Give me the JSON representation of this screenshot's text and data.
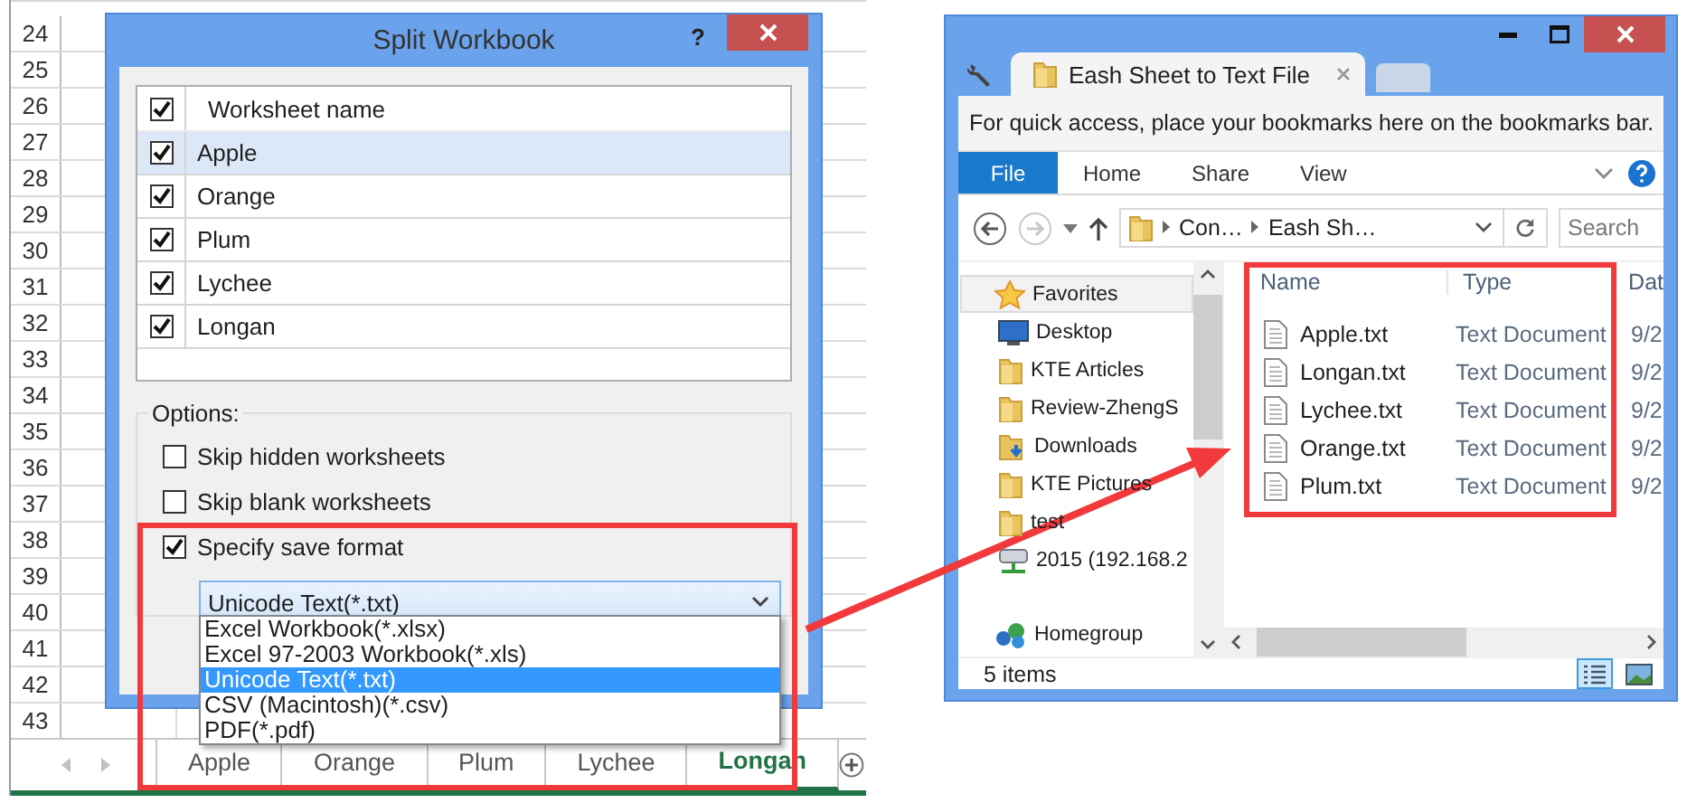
{
  "spreadsheet": {
    "row_numbers": [
      "24",
      "25",
      "26",
      "27",
      "28",
      "29",
      "30",
      "31",
      "32",
      "33",
      "34",
      "35",
      "36",
      "37",
      "38",
      "39",
      "40",
      "41",
      "42",
      "43"
    ],
    "sheet_tabs": [
      {
        "label": "Apple",
        "selected": false
      },
      {
        "label": "Orange",
        "selected": false
      },
      {
        "label": "Plum",
        "selected": false
      },
      {
        "label": "Lychee",
        "selected": false
      },
      {
        "label": "Longan",
        "selected": true
      }
    ]
  },
  "dialog": {
    "title": "Split Workbook",
    "help": "?",
    "worksheet_list": {
      "header": {
        "label": "Worksheet name",
        "checked": true
      },
      "rows": [
        {
          "label": "Apple",
          "checked": true,
          "selected": true
        },
        {
          "label": "Orange",
          "checked": true,
          "selected": false
        },
        {
          "label": "Plum",
          "checked": true,
          "selected": false
        },
        {
          "label": "Lychee",
          "checked": true,
          "selected": false
        },
        {
          "label": "Longan",
          "checked": true,
          "selected": false
        }
      ]
    },
    "options": {
      "title": "Options:",
      "items": [
        {
          "label": "Skip hidden worksheets",
          "checked": false
        },
        {
          "label": "Skip blank worksheets",
          "checked": false
        },
        {
          "label": "Specify save format",
          "checked": true
        }
      ],
      "format_dropdown": {
        "value": "Unicode Text(*.txt)",
        "options": [
          {
            "label": "Excel Workbook(*.xlsx)",
            "selected": false
          },
          {
            "label": "Excel 97-2003 Workbook(*.xls)",
            "selected": false
          },
          {
            "label": "Unicode Text(*.txt)",
            "selected": true
          },
          {
            "label": "CSV (Macintosh)(*.csv)",
            "selected": false
          },
          {
            "label": "PDF(*.pdf)",
            "selected": false
          }
        ]
      }
    }
  },
  "explorer": {
    "tab_title": "Eash Sheet to Text File",
    "bookmarks_hint": "For quick access, place your bookmarks here on the bookmarks bar.",
    "ribbon_tabs": [
      {
        "label": "File",
        "selected": true
      },
      {
        "label": "Home",
        "selected": false
      },
      {
        "label": "Share",
        "selected": false
      },
      {
        "label": "View",
        "selected": false
      }
    ],
    "breadcrumbs": [
      "Con…",
      "Eash Sh…"
    ],
    "search_placeholder": "Search",
    "nav_tree": [
      {
        "label": "Favorites",
        "kind": "star",
        "selected": true,
        "children": [
          {
            "label": "Desktop",
            "kind": "desktop",
            "selected": false
          },
          {
            "label": "KTE Articles",
            "kind": "folder",
            "selected": false
          },
          {
            "label": "Review-ZhengS",
            "kind": "folder",
            "selected": false
          },
          {
            "label": "Downloads",
            "kind": "downloads",
            "selected": false
          },
          {
            "label": "KTE Pictures",
            "kind": "folder",
            "selected": false
          },
          {
            "label": "test",
            "kind": "folder",
            "selected": false
          },
          {
            "label": "2015 (192.168.2",
            "kind": "network",
            "selected": false
          }
        ]
      },
      {
        "label": "Homegroup",
        "kind": "homegroup",
        "selected": false
      }
    ],
    "columns": [
      "Name",
      "Type",
      "Dat"
    ],
    "files": [
      {
        "name": "Apple.txt",
        "type": "Text Document",
        "date": "9/2"
      },
      {
        "name": "Longan.txt",
        "type": "Text Document",
        "date": "9/2"
      },
      {
        "name": "Lychee.txt",
        "type": "Text Document",
        "date": "9/2"
      },
      {
        "name": "Orange.txt",
        "type": "Text Document",
        "date": "9/2"
      },
      {
        "name": "Plum.txt",
        "type": "Text Document",
        "date": "9/2"
      }
    ],
    "status": "5 items"
  }
}
